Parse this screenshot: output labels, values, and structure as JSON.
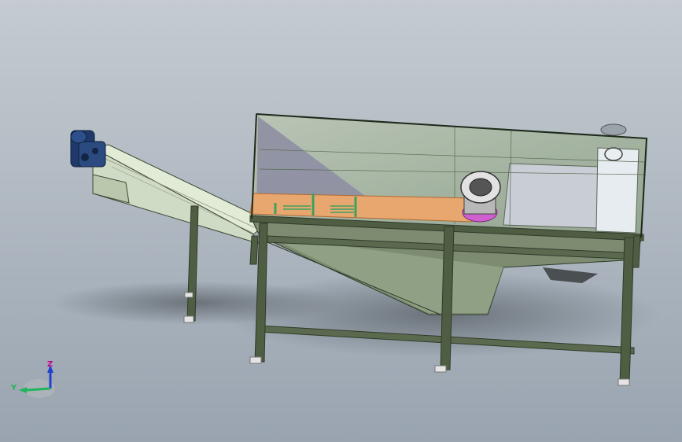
{
  "viewport": {
    "background_top": "#c4cbd1",
    "background_bottom": "#99a4b0"
  },
  "colors": {
    "frame": "#4f5d43",
    "frame_dark": "#2f3a2a",
    "panel": "#dfe8d4",
    "glass": "#a9b8a0",
    "tray": "#e9a770",
    "flange": "#d9d9d9",
    "motor": "#1f3a6a",
    "pink": "#c060c0",
    "shadow": "#6f7880"
  },
  "model": {
    "parts": [
      "conveyor-trough",
      "drive-motor",
      "screen-tank",
      "inlet-flange",
      "frame-legs"
    ]
  },
  "triad": {
    "z_label": "Z",
    "y_label": "Y",
    "z_color": "#c00090",
    "y_color": "#1fb55a",
    "x_color": "#2040d0"
  }
}
